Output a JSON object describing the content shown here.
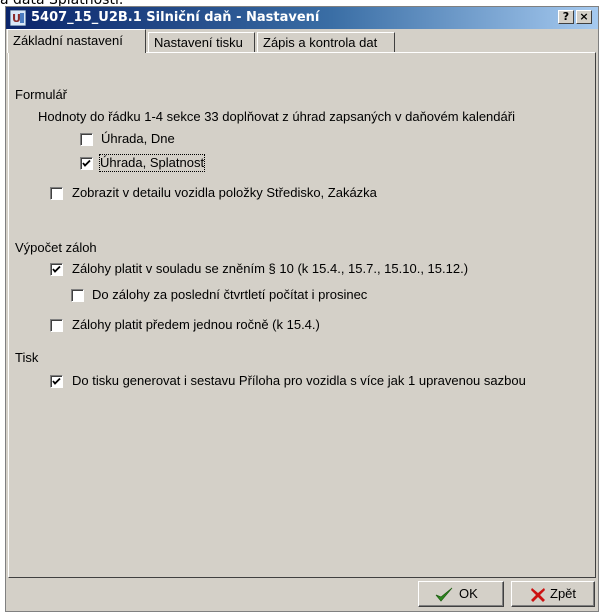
{
  "background_fragment": "a data Splatnosti.",
  "window": {
    "title": "5407_15_U2B.1 Silniční daň - Nastavení",
    "help_button": "?",
    "close_button": "×"
  },
  "tabs": [
    {
      "label": "Základní nastavení",
      "active": true
    },
    {
      "label": "Nastavení tisku",
      "active": false
    },
    {
      "label": "Zápis a kontrola dat",
      "active": false
    }
  ],
  "formular": {
    "heading": "Formulář",
    "description": "Hodnoty do řádku 1-4 sekce 33 doplňovat z úhrad zapsaných v daňovém kalendáři",
    "uhrada_dne": {
      "label": "Úhrada, Dne",
      "checked": false
    },
    "uhrada_splatnost": {
      "label": "Úhrada, Splatnost",
      "checked": true
    },
    "zobrazit": {
      "label": "Zobrazit v detailu vozidla položky Středisko, Zakázka",
      "checked": false
    }
  },
  "vypocet": {
    "heading": "Výpočet záloh",
    "zalohy_souladu": {
      "label": "Zálohy platit v souladu se zněním § 10 (k 15.4., 15.7., 15.10., 15.12.)",
      "checked": true
    },
    "do_zalohy": {
      "label": "Do zálohy za poslední čtvrtletí počítat i prosinec",
      "checked": false
    },
    "zalohy_predem": {
      "label": "Zálohy platit předem jednou ročně (k 15.4.)",
      "checked": false
    }
  },
  "tisk": {
    "heading": "Tisk",
    "generovat": {
      "label": "Do tisku generovat i sestavu Příloha pro vozidla s více jak 1 upravenou sazbou",
      "checked": true
    }
  },
  "buttons": {
    "ok": {
      "label": "OK",
      "icon": "check-icon",
      "color": "#2e8b1f"
    },
    "zpet": {
      "label": "Zpět",
      "icon": "cross-icon",
      "color": "#cc1111"
    }
  }
}
